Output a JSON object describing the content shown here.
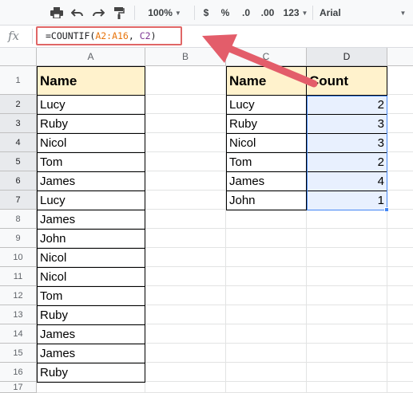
{
  "toolbar": {
    "zoom": "100%",
    "currency": "$",
    "percent": "%",
    "decrease_decimals": ".0",
    "increase_decimals": ".00",
    "more_formats": "123",
    "font": "Arial"
  },
  "formula_bar": {
    "fx_label": "fx",
    "formula_prefix": "=COUNTIF(",
    "formula_ref1": "A2:A16",
    "formula_sep": ", ",
    "formula_ref2": "C2",
    "formula_suffix": ")"
  },
  "columns": [
    "A",
    "B",
    "C",
    "D"
  ],
  "rows": [
    "1",
    "2",
    "3",
    "4",
    "5",
    "6",
    "7",
    "8",
    "9",
    "10",
    "11",
    "12",
    "13",
    "14",
    "15",
    "16",
    "17"
  ],
  "column_a": {
    "header": "Name",
    "values": [
      "Lucy",
      "Ruby",
      "Nicol",
      "Tom",
      "James",
      "Lucy",
      "James",
      "John",
      "Nicol",
      "Nicol",
      "Tom",
      "Ruby",
      "James",
      "James",
      "Ruby"
    ]
  },
  "summary": {
    "name_header": "Name",
    "count_header": "Count",
    "names": [
      "Lucy",
      "Ruby",
      "Nicol",
      "Tom",
      "James",
      "John"
    ],
    "counts": [
      "2",
      "3",
      "3",
      "2",
      "4",
      "1"
    ]
  },
  "colors": {
    "header_fill": "#fff2cc",
    "selection": "#4285f4",
    "selection_fill": "#e8f0fe",
    "highlight_box": "#e06666",
    "arrow": "#e35d6a"
  }
}
